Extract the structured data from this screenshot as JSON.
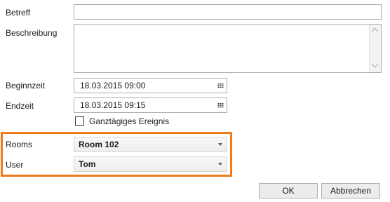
{
  "form": {
    "subject": {
      "label": "Betreff",
      "value": ""
    },
    "description": {
      "label": "Beschreibung",
      "value": ""
    },
    "start_time": {
      "label": "Beginnzeit",
      "value": "18.03.2015 09:00",
      "icon": "calendar-icon"
    },
    "end_time": {
      "label": "Endzeit",
      "value": "18.03.2015 09:15",
      "icon": "calendar-icon"
    },
    "all_day": {
      "label": "Ganztägiges Ereignis",
      "checked": false
    },
    "rooms": {
      "label": "Rooms",
      "selected": "Room 102"
    },
    "user": {
      "label": "User",
      "selected": "Tom"
    }
  },
  "buttons": {
    "ok_label": "OK",
    "cancel_label": "Abbrechen"
  },
  "colors": {
    "highlight_border": "#f07c19",
    "field_border": "#acacac"
  }
}
